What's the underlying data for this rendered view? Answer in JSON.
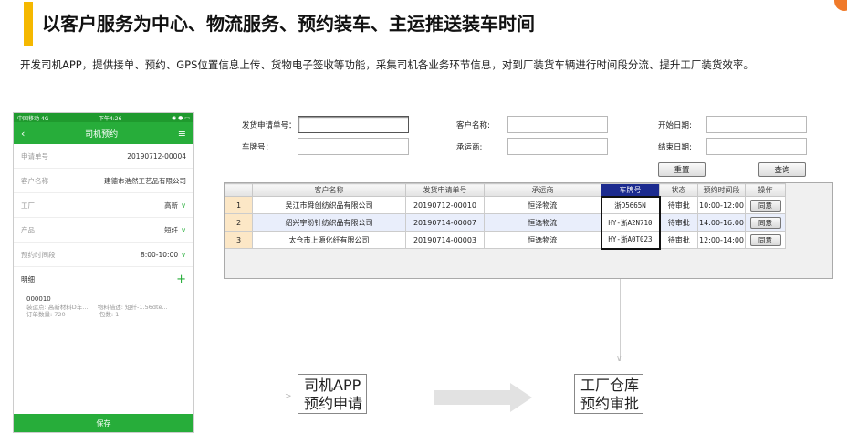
{
  "header": {
    "title": "以客户服务为中心、物流服务、预约装车、主运推送装车时间",
    "description": "开发司机APP，提供接单、预约、GPS位置信息上传、货物电子签收等功能，采集司机各业务环节信息，对到厂装货车辆进行时间段分流、提升工厂装货效率。"
  },
  "phone": {
    "status_left": "中国移动 4G",
    "status_time": "下午4:26",
    "status_right": "◉ ● ▭",
    "nav_back": "‹",
    "nav_title": "司机预约",
    "nav_menu": "≡",
    "rows": [
      {
        "label": "申请单号",
        "value": "20190712-00004"
      },
      {
        "label": "客户名称",
        "value": "建德市浩然工艺品有限公司"
      },
      {
        "label": "工厂",
        "value": "高新"
      },
      {
        "label": "产品",
        "value": "短纤"
      },
      {
        "label": "预约时间段",
        "value": "8:00-10:00"
      }
    ],
    "chevron": "∨",
    "detail_label": "明细",
    "detail_plus": "+",
    "detail_code": "000010",
    "detail_line1": "装运点: 高新材料D车...     物料描述: 短纤-1.56dte...",
    "detail_line2": "订单数量: 720                  包数: 1",
    "save_label": "保存"
  },
  "form": {
    "label_app_no": "发货申请单号：",
    "label_customer": "客户名称:",
    "label_start": "开始日期:",
    "label_plate": "车牌号：",
    "label_carrier": "承运商:",
    "label_end": "结束日期:",
    "reset_label": "重置",
    "query_label": "查询"
  },
  "grid": {
    "columns": [
      "",
      "客户名称",
      "发货申请单号",
      "承运商",
      "车牌号",
      "状态",
      "预约时间段",
      "操作"
    ],
    "rows": [
      {
        "no": "1",
        "customer": "吴江市舜创纺织品有限公司",
        "app_no": "20190712-00010",
        "carrier": "恒泽物流",
        "plate": "浙D5665N",
        "status": "待审批",
        "slot": "10:00-12:00",
        "action": "同意"
      },
      {
        "no": "2",
        "customer": "绍兴宇盼针纺织品有限公司",
        "app_no": "20190714-00007",
        "carrier": "恒逸物流",
        "plate": "HY-浙A2N710",
        "status": "待审批",
        "slot": "14:00-16:00",
        "action": "同意"
      },
      {
        "no": "3",
        "customer": "太仓市上源化纤有限公司",
        "app_no": "20190714-00003",
        "carrier": "恒逸物流",
        "plate": "HY-浙A0T023",
        "status": "待审批",
        "slot": "12:00-14:00",
        "action": "同意"
      }
    ]
  },
  "flow": {
    "app_line1": "司机APP",
    "app_line2": "预约申请",
    "wh_line1": "工厂仓库",
    "wh_line2": "预约审批"
  },
  "colors": {
    "accent": "#f5b800",
    "brand_green": "#27ad3a",
    "highlight_header": "#1c2b8f"
  }
}
